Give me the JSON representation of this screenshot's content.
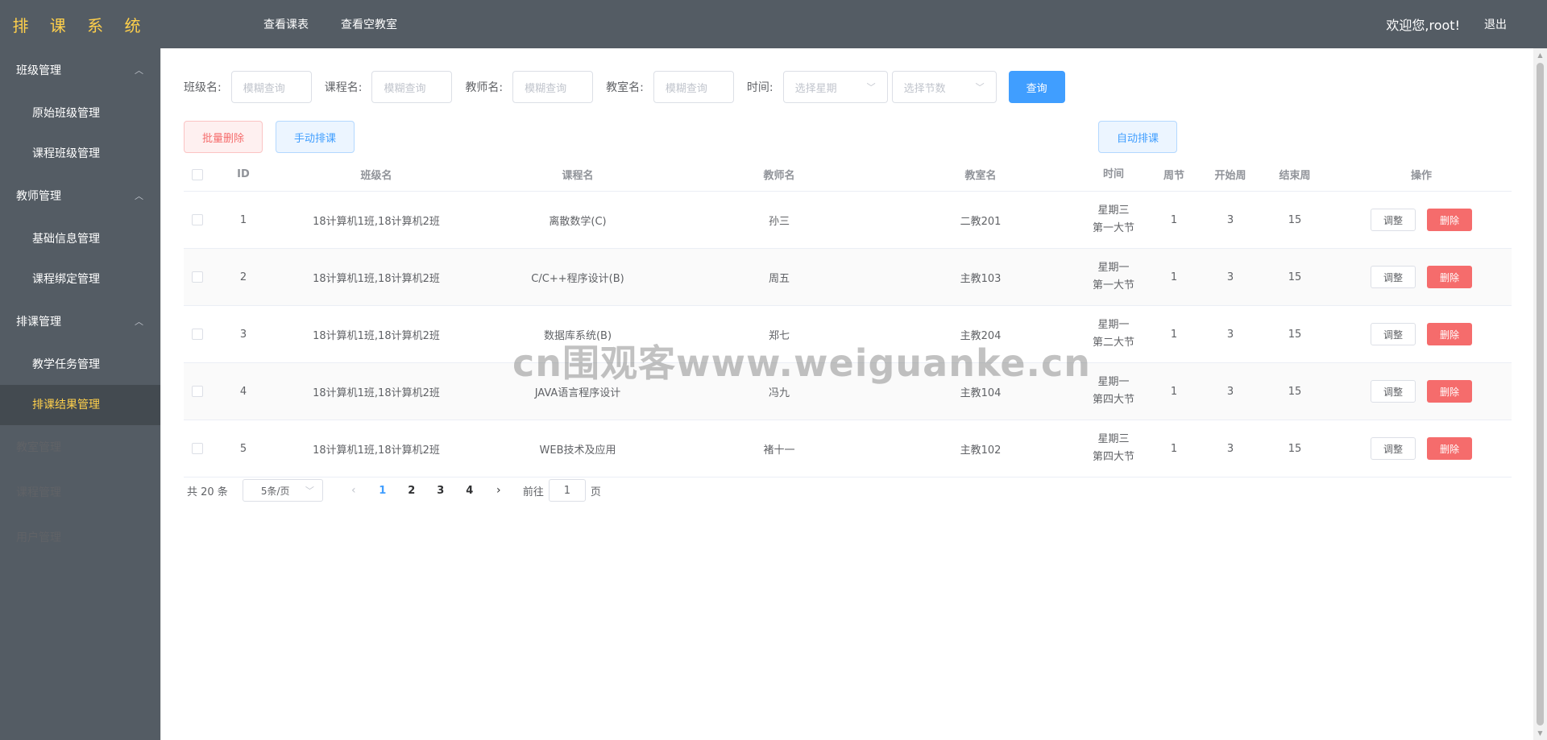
{
  "header": {
    "logo": "排 课 系 统",
    "nav": [
      "查看课表",
      "查看空教室"
    ],
    "welcome": "欢迎您,root!",
    "logout": "退出"
  },
  "sidebar": {
    "groups": [
      {
        "title": "班级管理",
        "items": [
          "原始班级管理",
          "课程班级管理"
        ]
      },
      {
        "title": "教师管理",
        "items": [
          "基础信息管理",
          "课程绑定管理"
        ]
      },
      {
        "title": "排课管理",
        "items": [
          "教学任务管理",
          "排课结果管理"
        ]
      }
    ],
    "singles": [
      "教室管理",
      "课程管理",
      "用户管理"
    ],
    "active_item": "排课结果管理"
  },
  "filters": {
    "class_label": "班级名:",
    "class_placeholder": "模糊查询",
    "course_label": "课程名:",
    "course_placeholder": "模糊查询",
    "teacher_label": "教师名:",
    "teacher_placeholder": "模糊查询",
    "room_label": "教室名:",
    "room_placeholder": "模糊查询",
    "time_label": "时间:",
    "weekday_placeholder": "选择星期",
    "section_placeholder": "选择节数",
    "search_button": "查询"
  },
  "actions": {
    "batch_delete": "批量删除",
    "manual_schedule": "手动排课",
    "auto_schedule": "自动排课"
  },
  "table": {
    "columns": [
      "ID",
      "班级名",
      "课程名",
      "教师名",
      "教室名",
      "时间",
      "周节",
      "开始周",
      "结束周",
      "操作"
    ],
    "adjust_label": "调整",
    "delete_label": "删除",
    "rows": [
      {
        "id": "1",
        "class": "18计算机1班,18计算机2班",
        "course": "离散数学(C)",
        "teacher": "孙三",
        "room": "二教201",
        "day": "星期三",
        "section": "第一大节",
        "wk": "1",
        "start": "3",
        "end": "15"
      },
      {
        "id": "2",
        "class": "18计算机1班,18计算机2班",
        "course": "C/C++程序设计(B)",
        "teacher": "周五",
        "room": "主教103",
        "day": "星期一",
        "section": "第一大节",
        "wk": "1",
        "start": "3",
        "end": "15"
      },
      {
        "id": "3",
        "class": "18计算机1班,18计算机2班",
        "course": "数据库系统(B)",
        "teacher": "郑七",
        "room": "主教204",
        "day": "星期一",
        "section": "第二大节",
        "wk": "1",
        "start": "3",
        "end": "15"
      },
      {
        "id": "4",
        "class": "18计算机1班,18计算机2班",
        "course": "JAVA语言程序设计",
        "teacher": "冯九",
        "room": "主教104",
        "day": "星期一",
        "section": "第四大节",
        "wk": "1",
        "start": "3",
        "end": "15"
      },
      {
        "id": "5",
        "class": "18计算机1班,18计算机2班",
        "course": "WEB技术及应用",
        "teacher": "褚十一",
        "room": "主教102",
        "day": "星期三",
        "section": "第四大节",
        "wk": "1",
        "start": "3",
        "end": "15"
      }
    ]
  },
  "pagination": {
    "total": "共 20 条",
    "page_size": "5条/页",
    "pages": [
      "1",
      "2",
      "3",
      "4"
    ],
    "current": "1",
    "goto_prefix": "前往",
    "goto_value": "1",
    "goto_suffix": "页"
  },
  "watermark": "cn围观客www.weiguanke.cn"
}
